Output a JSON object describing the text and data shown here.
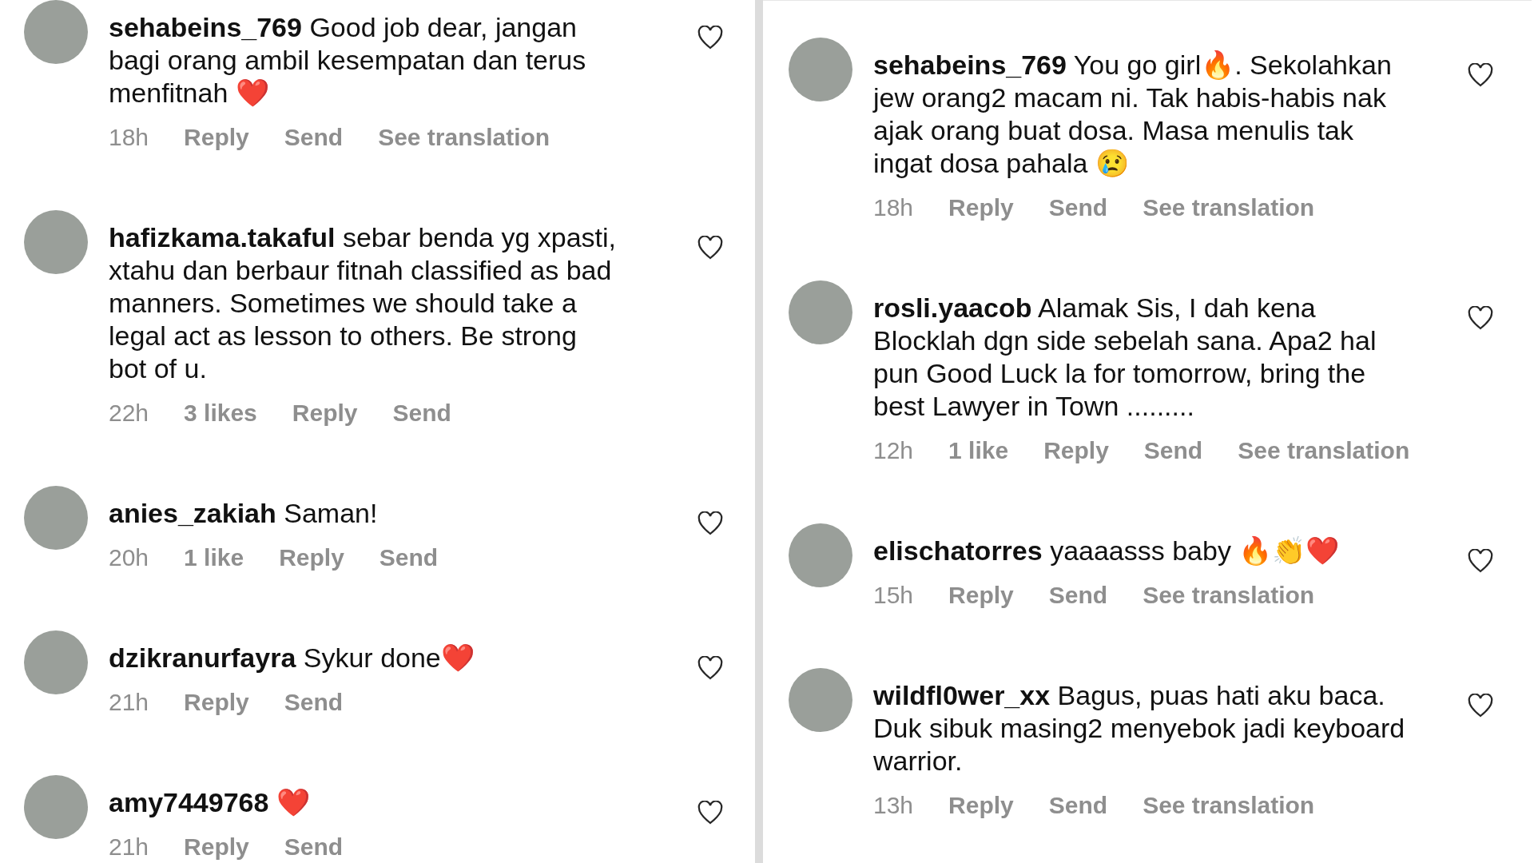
{
  "columns": [
    {
      "comments": [
        {
          "user": "sehabeins_769",
          "text": "Good job dear, jangan bagi orang ambil kesempatan dan terus menfitnah ❤️",
          "meta": [
            {
              "kind": "time",
              "text": "18h"
            },
            {
              "kind": "action",
              "text": "Reply"
            },
            {
              "kind": "action",
              "text": "Send"
            },
            {
              "kind": "action",
              "text": "See translation"
            }
          ]
        },
        {
          "user": "hafizkama.takaful",
          "text": "sebar benda yg xpasti, xtahu dan berbaur fitnah classified as bad manners. Sometimes we should take a legal act as lesson to others. Be strong bot of u.",
          "meta": [
            {
              "kind": "time",
              "text": "22h"
            },
            {
              "kind": "action",
              "text": "3 likes"
            },
            {
              "kind": "action",
              "text": "Reply"
            },
            {
              "kind": "action",
              "text": "Send"
            }
          ]
        },
        {
          "user": "anies_zakiah",
          "text": "Saman!",
          "meta": [
            {
              "kind": "time",
              "text": "20h"
            },
            {
              "kind": "action",
              "text": "1 like"
            },
            {
              "kind": "action",
              "text": "Reply"
            },
            {
              "kind": "action",
              "text": "Send"
            }
          ]
        },
        {
          "user": "dzikranurfayra",
          "text": "Sykur done❤️",
          "meta": [
            {
              "kind": "time",
              "text": "21h"
            },
            {
              "kind": "action",
              "text": "Reply"
            },
            {
              "kind": "action",
              "text": "Send"
            }
          ]
        },
        {
          "user": "amy7449768",
          "text": "❤️",
          "meta": [
            {
              "kind": "time",
              "text": "21h"
            },
            {
              "kind": "action",
              "text": "Reply"
            },
            {
              "kind": "action",
              "text": "Send"
            }
          ]
        }
      ]
    },
    {
      "comments": [
        {
          "user": "sehabeins_769",
          "text": "You go girl🔥. Sekolahkan jew orang2 macam ni. Tak habis-habis nak ajak orang buat dosa. Masa menulis tak ingat dosa pahala 😢",
          "meta": [
            {
              "kind": "time",
              "text": "18h"
            },
            {
              "kind": "action",
              "text": "Reply"
            },
            {
              "kind": "action",
              "text": "Send"
            },
            {
              "kind": "action",
              "text": "See translation"
            }
          ]
        },
        {
          "user": "rosli.yaacob",
          "text": "Alamak Sis, I dah kena Blocklah dgn side sebelah sana. Apa2 hal pun Good Luck la for tomorrow, bring the best Lawyer in Town .........",
          "meta": [
            {
              "kind": "time",
              "text": "12h"
            },
            {
              "kind": "action",
              "text": "1 like"
            },
            {
              "kind": "action",
              "text": "Reply"
            },
            {
              "kind": "action",
              "text": "Send"
            },
            {
              "kind": "action",
              "text": "See translation"
            }
          ]
        },
        {
          "user": "elischatorres",
          "text": "yaaaasss baby 🔥👏❤️",
          "meta": [
            {
              "kind": "time",
              "text": "15h"
            },
            {
              "kind": "action",
              "text": "Reply"
            },
            {
              "kind": "action",
              "text": "Send"
            },
            {
              "kind": "action",
              "text": "See translation"
            }
          ]
        },
        {
          "user": "wildfl0wer_xx",
          "text": "Bagus, puas hati aku baca. Duk sibuk masing2 menyebok jadi keyboard warrior.",
          "meta": [
            {
              "kind": "time",
              "text": "13h"
            },
            {
              "kind": "action",
              "text": "Reply"
            },
            {
              "kind": "action",
              "text": "Send"
            },
            {
              "kind": "action",
              "text": "See translation"
            }
          ]
        }
      ]
    }
  ]
}
